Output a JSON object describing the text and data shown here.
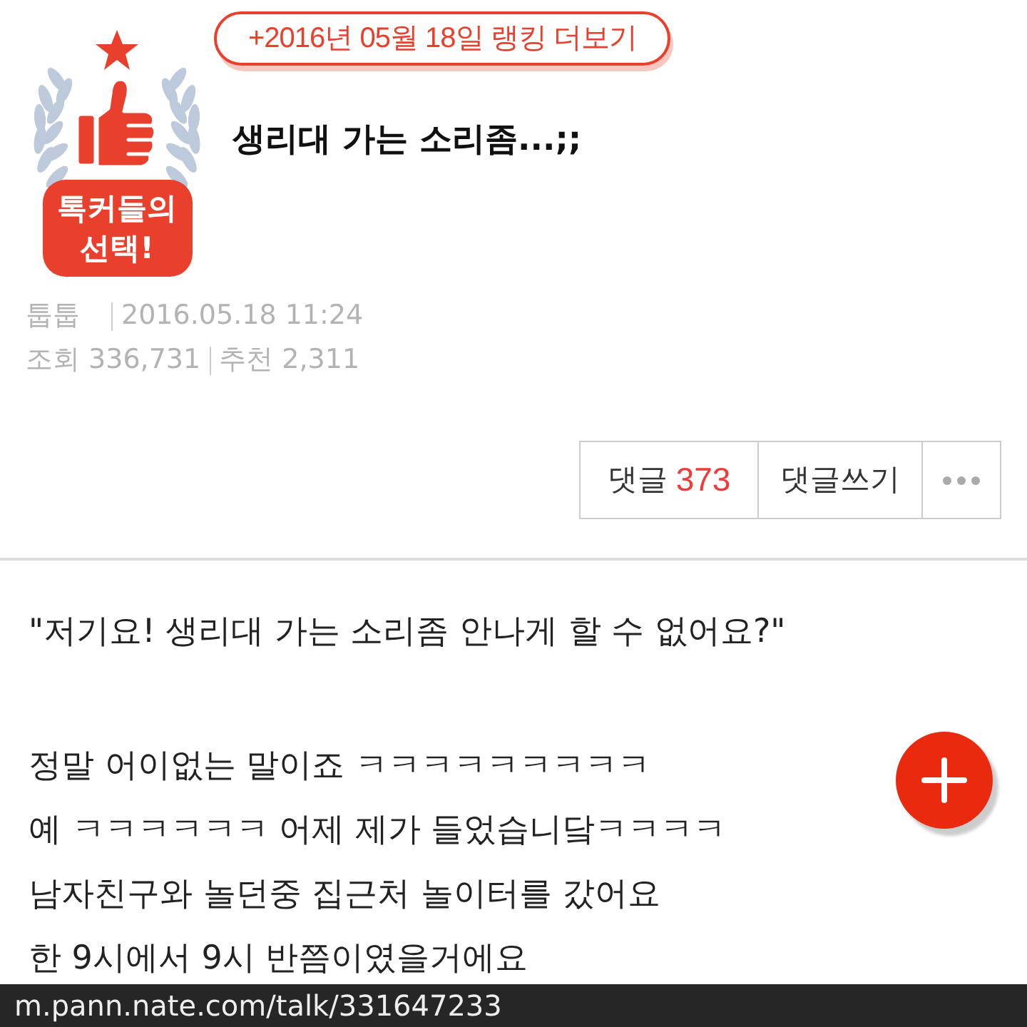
{
  "ranking_link": {
    "label": "+2016년 05월 18일 랭킹 더보기"
  },
  "badge": {
    "lines": [
      "톡커들의",
      "선택!"
    ]
  },
  "post": {
    "title": "생리대 가는 소리좀...;;",
    "author": "툽툽",
    "date": "2016.05.18 11:24",
    "stats": [
      "조회 336,731",
      "추천 2,311"
    ]
  },
  "actions": [
    {
      "kind": "comments",
      "label": "댓글",
      "count": "373"
    },
    {
      "kind": "write",
      "label": "댓글쓰기"
    },
    {
      "kind": "more"
    }
  ],
  "body": {
    "paragraphs": [
      [
        "\"저기요! 생리대 가는 소리좀 안나게 할 수 없어요?\""
      ],
      [
        "정말 어이없는 말이죠 ㅋㅋㅋㅋㅋㅋㅋㅋㅋ",
        "예 ㅋㅋㅋㅋㅋㅋ 어제 제가 들었습니닼ㅋㅋㅋㅋ",
        "남자친구와 놀던중 집근처 놀이터를 갔어요",
        "한 9시에서 9시 반쯤이였을거에요"
      ]
    ]
  },
  "url_bar": {
    "url": "m.pann.nate.com/talk/331647233"
  }
}
